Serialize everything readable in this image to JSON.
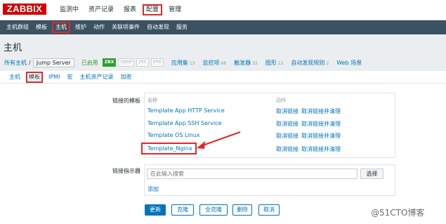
{
  "logo": "ZABBIX",
  "top_nav": [
    "监测中",
    "资产记录",
    "报表",
    "配置",
    "管理"
  ],
  "sub_nav": [
    "主机群组",
    "模板",
    "主机",
    "维护",
    "动作",
    "关联项事件",
    "自动发现",
    "服务"
  ],
  "page_title": "主机",
  "breadcrumb": {
    "all_hosts": "所有主机",
    "separator": "/",
    "current_host": "Jump Server",
    "status": "已启用",
    "availability": [
      "ZBX",
      "SNMP",
      "JMX",
      "IPMI"
    ],
    "links": [
      {
        "label": "应用集",
        "count": "13"
      },
      {
        "label": "监控项",
        "count": "68"
      },
      {
        "label": "触发器",
        "count": "32"
      },
      {
        "label": "图形",
        "count": "12"
      },
      {
        "label": "自动发现规则",
        "count": "2"
      },
      {
        "label": "Web 场景",
        "count": ""
      }
    ]
  },
  "tabs": [
    "主机",
    "模板",
    "IPMI",
    "宏",
    "主机资产记录",
    "加密"
  ],
  "linked_templates": {
    "label": "链接的模板",
    "col_name": "名称",
    "col_action": "动作",
    "rows": [
      {
        "name": "Template App HTTP Service",
        "unlink": "取消链接",
        "unlink_clear": "取消链接并清理"
      },
      {
        "name": "Template App SSH Service",
        "unlink": "取消链接",
        "unlink_clear": "取消链接并清理"
      },
      {
        "name": "Template OS Linux",
        "unlink": "取消链接",
        "unlink_clear": "取消链接并清理"
      },
      {
        "name": "Template_Nginx",
        "unlink": "取消链接",
        "unlink_clear": "取消链接并清理"
      }
    ]
  },
  "link_indicator": {
    "label": "链接指示器",
    "placeholder": "在此输入搜索",
    "select_label": "选择",
    "add_label": "添加"
  },
  "buttons": {
    "update": "更新",
    "clone": "克隆",
    "full_clone": "全克隆",
    "delete": "删除",
    "cancel": "取消"
  },
  "watermark": "@51CTO博客",
  "colors": {
    "accent": "#0275b8",
    "highlight": "#e02828",
    "logo": "#d40000",
    "subnav_bg": "#3a5262",
    "enabled": "#2f9f2f"
  }
}
